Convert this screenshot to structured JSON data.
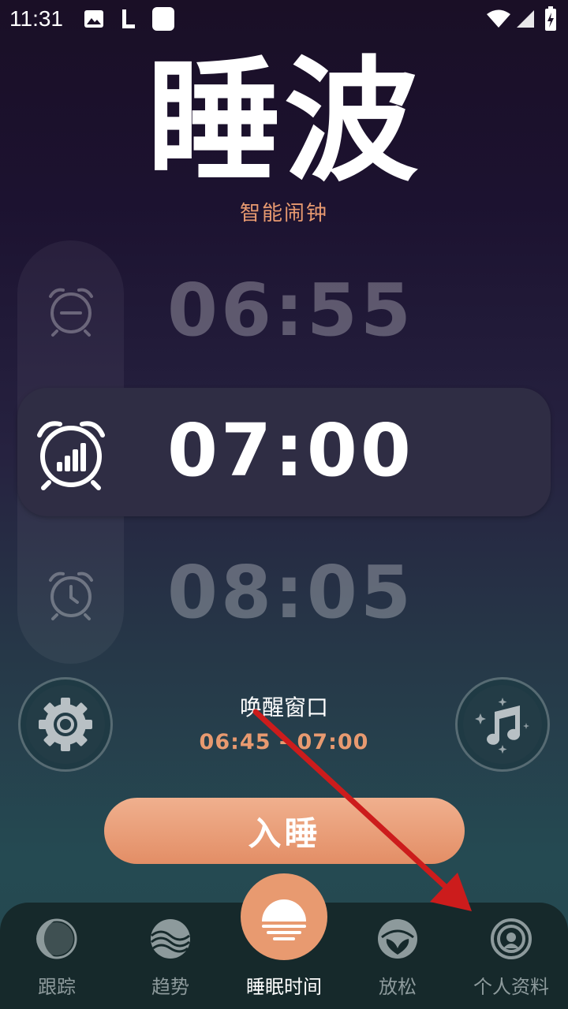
{
  "status_bar": {
    "time": "11:31"
  },
  "app": {
    "title": "睡波",
    "subtitle": "智能闹钟"
  },
  "alarms": [
    {
      "time": "06:55",
      "icon": "alarm-minus-icon",
      "state": "dim"
    },
    {
      "time": "07:00",
      "icon": "alarm-smart-icon",
      "state": "selected"
    },
    {
      "time": "08:05",
      "icon": "alarm-clock-icon",
      "state": "dim"
    }
  ],
  "wake_window": {
    "label": "唤醒窗口",
    "range": "06:45 - 07:00"
  },
  "buttons": {
    "settings_icon": "gear-icon",
    "music_icon": "music-icon",
    "sleep_label": "入睡"
  },
  "nav": [
    {
      "label": "跟踪",
      "icon": "moon-icon"
    },
    {
      "label": "趋势",
      "icon": "waves-icon"
    },
    {
      "label": "睡眠时间",
      "icon": "sunset-icon",
      "active": true
    },
    {
      "label": "放松",
      "icon": "relax-icon"
    },
    {
      "label": "个人资料",
      "icon": "profile-icon"
    }
  ],
  "colors": {
    "accent": "#e89a70",
    "nav_bg": "#16292b",
    "card_bg": "#2f2d44"
  }
}
